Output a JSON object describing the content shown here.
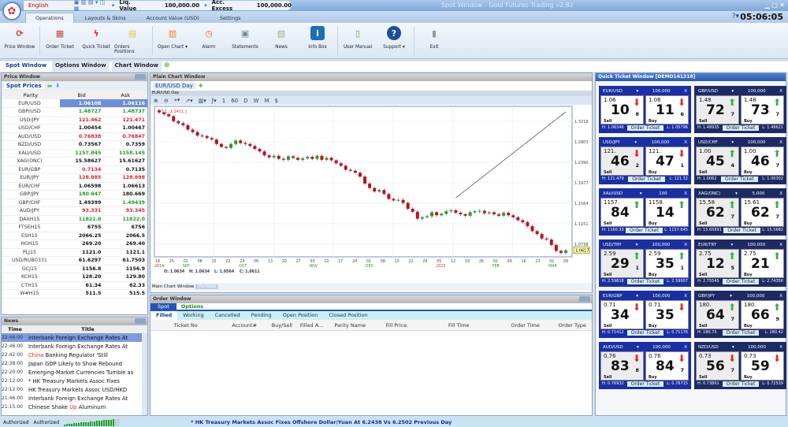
{
  "title_bar": {
    "language": "English",
    "liq_label": "Liq. Value",
    "liq_value": "100,000.00",
    "acc_label": "Acc. Excess",
    "acc_value": "100,000.00",
    "window_title": "Spot Window - Gold Futures Trading v2.82"
  },
  "ribbon_tabs": [
    "Operations",
    "Layouts & Skins",
    "Account Value (USD)",
    "Settings"
  ],
  "clock": "05:06:05",
  "ribbon_buttons": [
    {
      "label": "Price Window",
      "icon": "refresh-icon",
      "color": "#d33"
    },
    {
      "label": "Order Ticket",
      "icon": "order-ticket-icon",
      "color": "#c44"
    },
    {
      "label": "Quick Ticket",
      "icon": "lightning-icon",
      "color": "#e22"
    },
    {
      "label": "Orders Positions",
      "icon": "clipboard-icon",
      "color": "#dc3"
    },
    {
      "label": "Open Chart ▾",
      "icon": "bar-chart-icon",
      "color": "#e80"
    },
    {
      "label": "Alarm",
      "icon": "alarm-clock-icon",
      "color": "#e63"
    },
    {
      "label": "Statements",
      "icon": "statements-icon",
      "color": "#789"
    },
    {
      "label": "News",
      "icon": "news-icon",
      "color": "#aa8"
    },
    {
      "label": "Info Box",
      "icon": "info-icon",
      "color": "#1a6fb8"
    },
    {
      "label": "User Manual",
      "icon": "manual-icon",
      "color": "#6a4"
    },
    {
      "label": "Support ▾",
      "icon": "help-icon",
      "color": "#1a4da0"
    },
    {
      "label": "Exit",
      "icon": "exit-icon",
      "color": "#999"
    }
  ],
  "window_tabs": [
    "Spot Window",
    "Options Window",
    "Chart Window"
  ],
  "price_window": {
    "title": "Price Window",
    "tab": "Spot Prices",
    "columns": [
      "Parity",
      "Bid",
      "Ask"
    ],
    "rows": [
      [
        "EUR/USD",
        "1.06108",
        "1.06116",
        "w",
        "w"
      ],
      [
        "GBP/USD",
        "1.48727",
        "1.48737",
        "g",
        "g"
      ],
      [
        "USD/JPY",
        "121.462",
        "121.471",
        "r",
        "r"
      ],
      [
        "USD/CHF",
        "1.00454",
        "1.00467",
        "k",
        "k"
      ],
      [
        "AUD/USD",
        "0.76838",
        "0.76847",
        "r",
        "r"
      ],
      [
        "NZD/USD",
        "0.73567",
        "0.7359",
        "k",
        "k"
      ],
      [
        "XAU/USD",
        "1157.845",
        "1158.145",
        "g",
        "g"
      ],
      [
        "XAG(ONC)",
        "15.58627",
        "15.61627",
        "k",
        "k"
      ],
      [
        "EUR/GBP",
        "0.7134",
        "0.7135",
        "r",
        "k"
      ],
      [
        "EUR/JPY",
        "128.885",
        "128.898",
        "r",
        "r"
      ],
      [
        "EUR/CHF",
        "1.06598",
        "1.06613",
        "k",
        "k"
      ],
      [
        "GBP/JPY",
        "180.647",
        "180.669",
        "g",
        "k"
      ],
      [
        "GBP/CHF",
        "1.49399",
        "1.49439",
        "k",
        "g"
      ],
      [
        "AUD/JPY",
        "93.331",
        "93.345",
        "r",
        "r"
      ],
      [
        "DAXH15",
        "11821.0",
        "11822.0",
        "g",
        "g"
      ],
      [
        "FTSEH15",
        "6755",
        "6756",
        "k",
        "k"
      ],
      [
        "ESH15",
        "2066.25",
        "2066.5",
        "k",
        "k"
      ],
      [
        "HGH15",
        "269.20",
        "269.40",
        "k",
        "k"
      ],
      [
        "PLJ15",
        "1121.0",
        "1121.1",
        "k",
        "k"
      ],
      [
        "USD/RUB0331",
        "61.6297",
        "61.7503",
        "k",
        "k"
      ],
      [
        "GCJ15",
        "1156.8",
        "1156.9",
        "k",
        "k"
      ],
      [
        "KCH15",
        "128.20",
        "129.80",
        "k",
        "k"
      ],
      [
        "CTH15",
        "61.34",
        "62.33",
        "k",
        "k"
      ],
      [
        "W#H15",
        "511.5",
        "515.5",
        "k",
        "k"
      ]
    ]
  },
  "news": {
    "title": "News",
    "columns": [
      "Time",
      "Title"
    ],
    "rows": [
      [
        "22:46:00",
        "Interbank Foreign Exchange Rates At",
        ""
      ],
      [
        "22:46:00",
        "Interbank Foreign Exchange Rates At",
        ""
      ],
      [
        "22:42:00",
        "China Banking Regulator 'Still",
        "China"
      ],
      [
        "22:38:00",
        "Japan GDP Likely to Show Rebound",
        ""
      ],
      [
        "22:20:00",
        "Emerging-Market Currencies Tumble as",
        ""
      ],
      [
        "22:12:00",
        "* HK Treasury Markets Assoc Fixes",
        ""
      ],
      [
        "22:12:00",
        "HK Treasury Markets Assoc USD/HKD",
        ""
      ],
      [
        "21:46:00",
        "Interbank Foreign Exchange Rates At",
        ""
      ],
      [
        "21:15:00",
        "Chinese Shake Up Aluminum",
        "Up"
      ]
    ]
  },
  "status": {
    "auth1": "Authorized",
    "auth2": "Authorized",
    "ticker": "* HK Treasury Markets Assoc Fixes Offshore Dollar/Yuan At 6.2438 Vs 6.2502 Previous Day",
    "signal_strength": 0.9
  },
  "chart_window": {
    "title": "Plain Chart Window",
    "tab": "EUR/USD Day",
    "subtitle": "EUR/USD Day",
    "toolbar": [
      "1",
      "60",
      "D",
      "W",
      "M",
      "$"
    ],
    "indicator": "[ T 1 -1.1411 ]",
    "ohlc": {
      "o": "O: 1.0634",
      "h": "H: 1.0634",
      "l": "L: 1.0564",
      "c": "C: 1.0611"
    },
    "bottom_tabs": [
      "Main Chart Window",
      "Portfolio"
    ]
  },
  "chart_data": {
    "type": "candlestick",
    "symbol": "EUR/USD",
    "ylim": [
      1.048,
      1.352
    ],
    "yticks": [
      "1.3219",
      "1.2803",
      "1.2390",
      "1.1977",
      "1.1564",
      "1.1151",
      "1.0738"
    ],
    "last_price": "1.0617",
    "x_ticks": [
      "18",
      "25",
      "01",
      "08",
      "15",
      "22",
      "29",
      "06",
      "13",
      "20",
      "27",
      "03",
      "10",
      "17",
      "24",
      "01",
      "08",
      "15",
      "22",
      "29",
      "05",
      "12",
      "19",
      "26",
      "02",
      "09",
      "16",
      "23",
      "02",
      "09"
    ],
    "months": [
      {
        "at": 0,
        "label": "2014",
        "color": "#d22"
      },
      {
        "at": 2,
        "label": "SEP",
        "color": "#1a1"
      },
      {
        "at": 6,
        "label": "OCT",
        "color": "#1a1"
      },
      {
        "at": 11,
        "label": "NOV",
        "color": "#1a1"
      },
      {
        "at": 15,
        "label": "DEC",
        "color": "#1a1"
      },
      {
        "at": 20,
        "label": "2015",
        "color": "#d22"
      },
      {
        "at": 24,
        "label": "FEB",
        "color": "#1a1"
      },
      {
        "at": 28,
        "label": "MAR",
        "color": "#1a1"
      }
    ],
    "closes": [
      1.34,
      1.336,
      1.332,
      1.322,
      1.318,
      1.314,
      1.305,
      1.3,
      1.293,
      1.292,
      1.288,
      1.285,
      1.276,
      1.27,
      1.268,
      1.276,
      1.283,
      1.278,
      1.276,
      1.272,
      1.266,
      1.261,
      1.253,
      1.249,
      1.252,
      1.246,
      1.244,
      1.251,
      1.248,
      1.244,
      1.247,
      1.25,
      1.246,
      1.252,
      1.244,
      1.248,
      1.243,
      1.237,
      1.232,
      1.224,
      1.222,
      1.218,
      1.21,
      1.196,
      1.187,
      1.18,
      1.183,
      1.175,
      1.165,
      1.162,
      1.163,
      1.157,
      1.145,
      1.139,
      1.125,
      1.128,
      1.13,
      1.138,
      1.132,
      1.135,
      1.14,
      1.142,
      1.137,
      1.134,
      1.131,
      1.138,
      1.14,
      1.141,
      1.136,
      1.138,
      1.134,
      1.131,
      1.137,
      1.132,
      1.128,
      1.122,
      1.118,
      1.11,
      1.1,
      1.094,
      1.085,
      1.083,
      1.072,
      1.06,
      1.056,
      1.061
    ],
    "trendline": {
      "from": [
        62,
        1.167
      ],
      "to": [
        85,
        1.341
      ]
    }
  },
  "order_window": {
    "title": "Order Window",
    "tabs": [
      "Spot",
      "Options"
    ],
    "subtabs": [
      "Filled",
      "Working",
      "Cancelled",
      "Pending",
      "Open Position",
      "Closed Position"
    ],
    "columns": [
      "Ticket No",
      "Account#",
      "Buy/Sell",
      "Filled A...",
      "Parity Name",
      "Fill Price",
      "Fill Time",
      "Order Time",
      "Order Type"
    ]
  },
  "quick_ticket": {
    "title": "Quick Ticket Window [DEMO141318]",
    "order_label": "Order Ticket",
    "sell": "Sell",
    "buy": "Buy",
    "tickets": [
      {
        "sym": "EUR/USD",
        "qty": "100,000",
        "dir": "down",
        "sell": [
          "1.06",
          "10",
          "8"
        ],
        "buy": [
          "1.06",
          "11",
          "6"
        ],
        "hi": "H: 1.06346",
        "lo": "L: 1.05796"
      },
      {
        "sym": "GBP/USD",
        "qty": "100,000",
        "dir": "up",
        "sell": [
          "1.48",
          "72",
          "7"
        ],
        "buy": [
          "1.48",
          "73",
          "7"
        ],
        "hi": "H: 1.48935",
        "lo": "L: 1.48621"
      },
      {
        "sym": "USD/JPY",
        "qty": "100,000",
        "dir": "down",
        "sell": [
          "121.",
          "46",
          "2"
        ],
        "buy": [
          "121.",
          "47",
          "1"
        ],
        "hi": "H: 121.479",
        "lo": "L: 121.32"
      },
      {
        "sym": "USD/CHF",
        "qty": "100,000",
        "dir": "up",
        "sell": [
          "1.00",
          "45",
          "4"
        ],
        "buy": [
          "1.00",
          "46",
          "7"
        ],
        "hi": "H: 1.0062",
        "lo": "L: 1.00302"
      },
      {
        "sym": "XAU/USD",
        "qty": "100",
        "dir": "up",
        "sell": [
          "1157.",
          "84",
          ""
        ],
        "buy": [
          "1158.",
          "14",
          ""
        ],
        "hi": "H: 1160.33",
        "lo": "L: 1157.645"
      },
      {
        "sym": "XAG(ONC)",
        "qty": "5,000",
        "dir": "up",
        "sell": [
          "15.58",
          "62",
          "7"
        ],
        "buy": [
          "15.61",
          "62",
          "7"
        ],
        "hi": "H: 15.65891",
        "lo": "L: 15.5682"
      },
      {
        "sym": "USD/TRY",
        "qty": "100,000",
        "dir": "up",
        "sell": [
          "2.59",
          "29",
          "1"
        ],
        "buy": [
          "2.59",
          "35",
          "1"
        ],
        "hi": "H: 2.59818",
        "lo": "L: 2.59007"
      },
      {
        "sym": "EUR/TRY",
        "qty": "100,000",
        "dir": "up",
        "sell": [
          "2.75",
          "12",
          "5"
        ],
        "buy": [
          "2.75",
          "21",
          ""
        ],
        "hi": "H: 2.75545",
        "lo": "L: 2.74356"
      },
      {
        "sym": "EUR/GBP",
        "qty": "100,000",
        "dir": "down",
        "sell": [
          "0.71",
          "34",
          ""
        ],
        "buy": [
          "0.71",
          "35",
          ""
        ],
        "hi": "H: 0.71412",
        "lo": "L: 0.71176"
      },
      {
        "sym": "GBP/JPY",
        "qty": "100,000",
        "dir": "up",
        "sell": [
          "180.",
          "64",
          "7"
        ],
        "buy": [
          "180.",
          "66",
          "9"
        ],
        "hi": "H: 180.73",
        "lo": "L: 180.42"
      },
      {
        "sym": "AUD/USD",
        "qty": "100,000",
        "dir": "down",
        "sell": [
          "0.76",
          "83",
          "8"
        ],
        "buy": [
          "0.76",
          "84",
          "7"
        ],
        "hi": "H: 0.76932",
        "lo": "L: 0.76715"
      },
      {
        "sym": "NZD/USD",
        "qty": "100,000",
        "dir": "down",
        "sell": [
          "0.73",
          "56",
          "7"
        ],
        "buy": [
          "0.73",
          "59",
          ""
        ],
        "hi": "H: 0.73801",
        "lo": "L: 0.72539"
      }
    ]
  }
}
